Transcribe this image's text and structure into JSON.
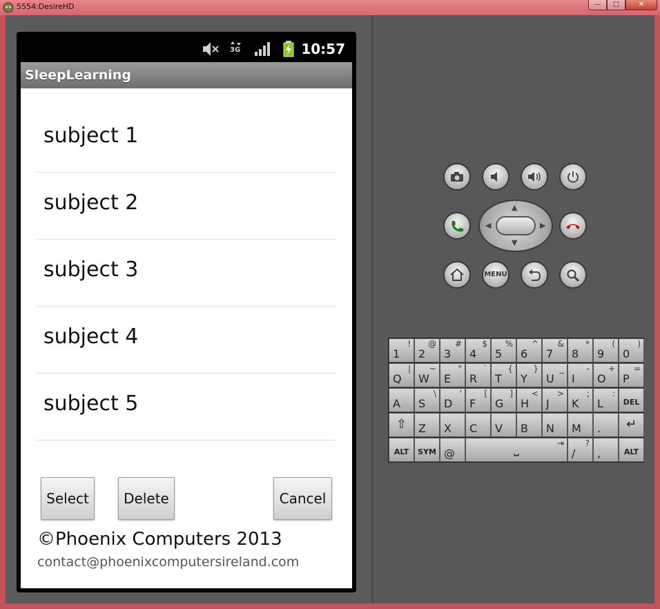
{
  "window": {
    "title": "5554:DesireHD",
    "minimize": "—",
    "maximize": "□",
    "close": "✕"
  },
  "status_bar": {
    "time": "10:57",
    "network": "3G",
    "icons": [
      "mute-icon",
      "data-activity-icon",
      "signal-icon",
      "battery-charging-icon"
    ]
  },
  "app": {
    "title": "SleepLearning"
  },
  "subjects": [
    {
      "label": "subject 1"
    },
    {
      "label": "subject 2"
    },
    {
      "label": "subject 3"
    },
    {
      "label": "subject 4"
    },
    {
      "label": "subject 5"
    }
  ],
  "buttons": {
    "select": "Select",
    "delete": "Delete",
    "cancel": "Cancel"
  },
  "footer": {
    "copyright": "©Phoenix Computers 2013",
    "contact": "contact@phoenixcomputersireland.com"
  },
  "hardware": {
    "menu_label": "MENU"
  },
  "keyboard": {
    "rows": [
      [
        {
          "k": "1",
          "a": "!"
        },
        {
          "k": "2",
          "a": "@"
        },
        {
          "k": "3",
          "a": "#"
        },
        {
          "k": "4",
          "a": "$"
        },
        {
          "k": "5",
          "a": "%"
        },
        {
          "k": "6",
          "a": "^"
        },
        {
          "k": "7",
          "a": "&"
        },
        {
          "k": "8",
          "a": "*"
        },
        {
          "k": "9",
          "a": "("
        },
        {
          "k": "0",
          "a": ")"
        }
      ],
      [
        {
          "k": "Q",
          "a": "|"
        },
        {
          "k": "W",
          "a": "~"
        },
        {
          "k": "E",
          "a": "\""
        },
        {
          "k": "R",
          "a": "`"
        },
        {
          "k": "T",
          "a": "{"
        },
        {
          "k": "Y",
          "a": "}"
        },
        {
          "k": "U",
          "a": "_"
        },
        {
          "k": "I",
          "a": "-"
        },
        {
          "k": "O",
          "a": "+"
        },
        {
          "k": "P",
          "a": "="
        }
      ],
      [
        {
          "k": "A",
          "a": ""
        },
        {
          "k": "S",
          "a": "\\"
        },
        {
          "k": "D",
          "a": "'"
        },
        {
          "k": "F",
          "a": "["
        },
        {
          "k": "G",
          "a": "]"
        },
        {
          "k": "H",
          "a": "<"
        },
        {
          "k": "J",
          "a": ">"
        },
        {
          "k": "K",
          "a": ";"
        },
        {
          "k": "L",
          "a": ":"
        },
        {
          "k": "DEL",
          "a": ""
        }
      ],
      [
        {
          "k": "⇧",
          "a": ""
        },
        {
          "k": "Z",
          "a": ""
        },
        {
          "k": "X",
          "a": ""
        },
        {
          "k": "C",
          "a": ""
        },
        {
          "k": "V",
          "a": ""
        },
        {
          "k": "B",
          "a": ""
        },
        {
          "k": "N",
          "a": ""
        },
        {
          "k": "M",
          "a": ""
        },
        {
          "k": ".",
          "a": ""
        },
        {
          "k": "↵",
          "a": ""
        }
      ]
    ],
    "bottom": {
      "alt_left": "ALT",
      "sym": "SYM",
      "at": "@",
      "space_glyph": "⎵",
      "tab_glyph": "⇥",
      "slash": "/",
      "question": "?",
      "comma": ",",
      "alt_right": "ALT"
    }
  }
}
